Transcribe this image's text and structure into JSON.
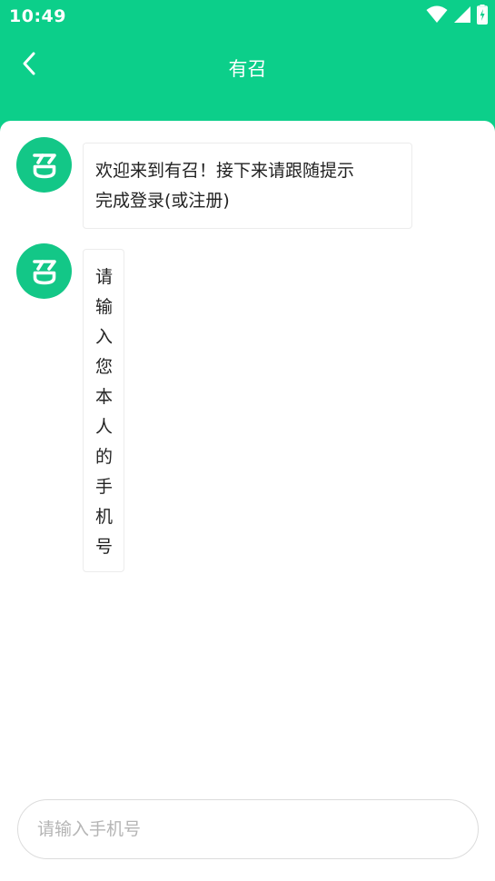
{
  "status_bar": {
    "time": "10:49",
    "icons": [
      "wifi-icon",
      "signal-icon",
      "battery-charging-icon"
    ]
  },
  "header": {
    "title": "有召",
    "back_icon": "chevron-left-icon"
  },
  "messages": [
    {
      "avatar_char": "召",
      "text_line1": "欢迎来到有召！接下来请跟随提示",
      "text_line2": "完成登录(或注册)"
    },
    {
      "avatar_char": "召",
      "text": "请输入您本人的手机号"
    }
  ],
  "input": {
    "placeholder": "请输入手机号",
    "value": ""
  },
  "colors": {
    "brand_green": "#0ccf8a",
    "avatar_green": "#13c787",
    "bubble_border": "#ececec",
    "input_border": "#dcdcdc"
  }
}
